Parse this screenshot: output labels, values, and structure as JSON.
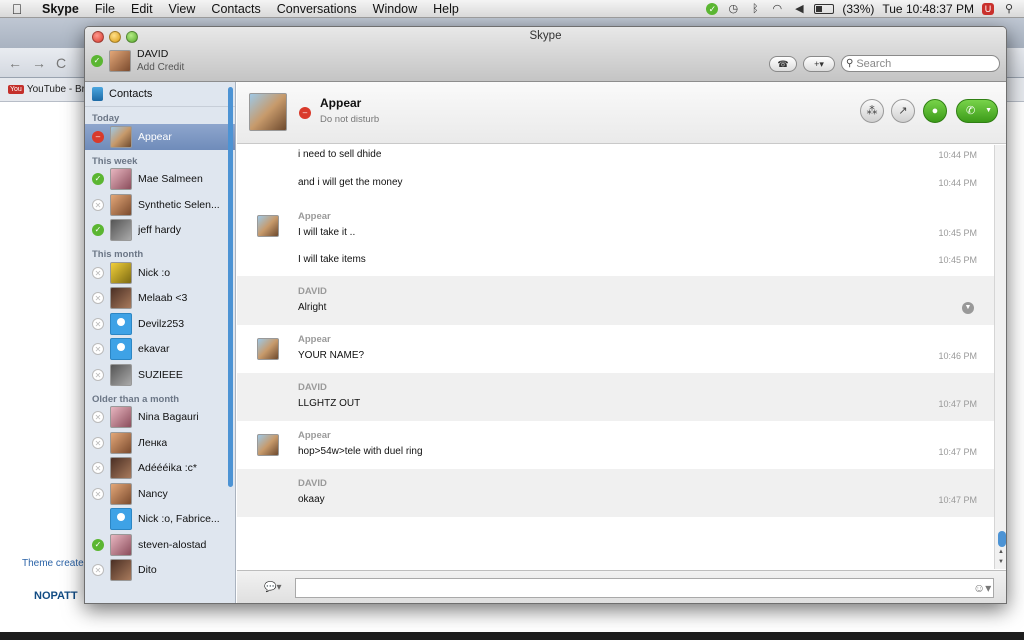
{
  "menubar": {
    "apple": "",
    "app_name": "Skype",
    "items": [
      "File",
      "Edit",
      "View",
      "Contacts",
      "Conversations",
      "Window",
      "Help"
    ],
    "battery": "(33%)",
    "clock": "Tue 10:48:37 PM"
  },
  "browser": {
    "bookmark_youtube": "YouTube - Br",
    "theme_credit": "Theme create",
    "nopatt": "NOPATT"
  },
  "window": {
    "title": "Skype",
    "me_name": "DAVID",
    "me_sub": "Add Credit",
    "search_placeholder": "Search",
    "dialpad_label": "☎",
    "add_label": "+▾"
  },
  "sidebar": {
    "contacts_label": "Contacts",
    "groups": {
      "today": "Today",
      "week": "This week",
      "month": "This month",
      "older": "Older than a month"
    },
    "contacts": [
      {
        "name": "Appear",
        "status": "dnd"
      },
      {
        "name": "Mae Salmeen",
        "status": "online"
      },
      {
        "name": "Synthetic Selen...",
        "status": "offline"
      },
      {
        "name": "jeff hardy",
        "status": "online"
      },
      {
        "name": "Nick :o",
        "status": "offline"
      },
      {
        "name": "Melaab <3",
        "status": "offline"
      },
      {
        "name": "Devilz253",
        "status": "offline"
      },
      {
        "name": "ekavar",
        "status": "offline"
      },
      {
        "name": "SUZIEEE",
        "status": "offline"
      },
      {
        "name": "Nina Bagauri",
        "status": "offline"
      },
      {
        "name": "Ленка",
        "status": "offline"
      },
      {
        "name": "Adéééika :c*",
        "status": "offline"
      },
      {
        "name": "Nancy",
        "status": "offline"
      },
      {
        "name": "Nick :o, Fabrice...",
        "status": "none"
      },
      {
        "name": "steven-alostad",
        "status": "online"
      },
      {
        "name": "Dito",
        "status": "offline"
      }
    ]
  },
  "chat": {
    "name": "Appear",
    "status": "Do not disturb",
    "messages": [
      {
        "text": "i need to sell dhide",
        "time": "10:44 PM"
      },
      {
        "text": "and i will get the money",
        "time": "10:44 PM"
      },
      {
        "sender": "Appear",
        "text": "I will take it ..",
        "time": "10:45 PM"
      },
      {
        "text": "I will take items",
        "time": "10:45 PM"
      },
      {
        "sender": "DAVID",
        "text": "Alright"
      },
      {
        "sender": "Appear",
        "text": "YOUR NAME?",
        "time": "10:46 PM"
      },
      {
        "sender": "DAVID",
        "text": "LLGHTZ OUT",
        "time": "10:47 PM"
      },
      {
        "sender": "Appear",
        "text": "hop>54w>tele with duel ring",
        "time": "10:47 PM"
      },
      {
        "sender": "DAVID",
        "text": "okaay",
        "time": "10:47 PM"
      }
    ],
    "input_value": ""
  }
}
